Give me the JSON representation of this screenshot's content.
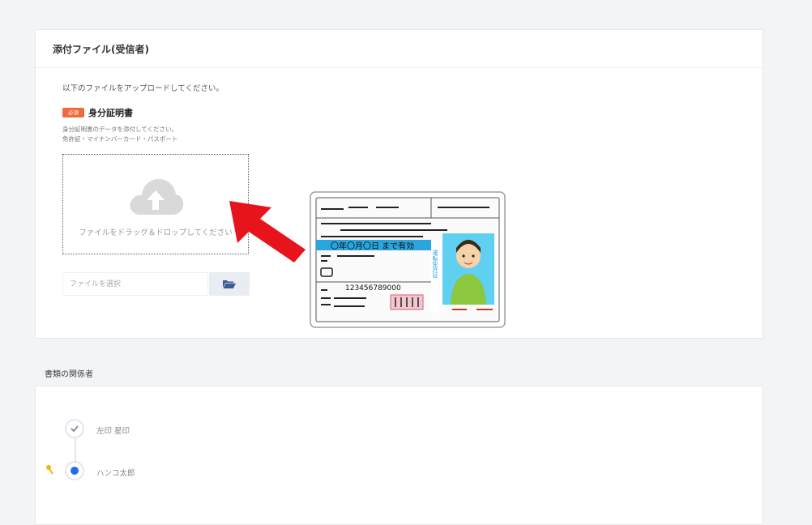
{
  "attachments": {
    "header": "添付ファイル(受信者)",
    "instruction": "以下のファイルをアップロードしてください。",
    "required_badge": "必須",
    "document_title": "身分証明書",
    "description_line1": "身分証明書のデータを添付してください。",
    "description_line2": "免許証・マイナンバーカード・パスポート",
    "dropzone_text": "ファイルをドラッグ＆ドロップしてください",
    "file_input_placeholder": "ファイルを選択"
  },
  "license": {
    "expiry_text": "〇年〇月〇日 まで有効",
    "number": "123456789000",
    "type_label": "運転免許証"
  },
  "parties": {
    "title": "書類の関係者",
    "steps": [
      {
        "name": "左印 星印",
        "status": "done"
      },
      {
        "name": "ハンコ太郎",
        "status": "current"
      }
    ]
  },
  "colors": {
    "badge": "#ef6a3c",
    "accent_blue": "#1f6fea",
    "arrow_red": "#e8141c",
    "license_blue": "#2aa6de"
  },
  "icons": [
    "cloud-upload-icon",
    "folder-open-icon",
    "check-icon",
    "key-icon",
    "arrow-icon"
  ]
}
